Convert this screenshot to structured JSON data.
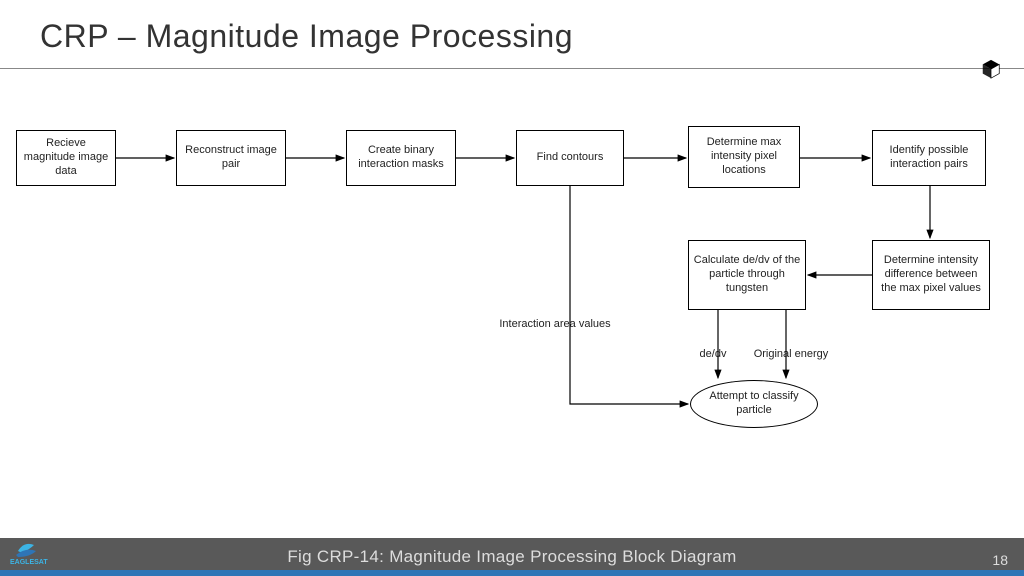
{
  "title": "CRP – Magnitude Image Processing",
  "footer": "Fig CRP-14: Magnitude Image Processing Block Diagram",
  "page": "18",
  "logo_text": "EAGLESAT",
  "boxes": {
    "b1": "Recieve magnitude image data",
    "b2": "Reconstruct image pair",
    "b3": "Create binary interaction masks",
    "b4": "Find contours",
    "b5": "Determine max intensity pixel locations",
    "b6": "Identify possible interaction pairs",
    "b7": "Determine intensity difference between the max pixel values",
    "b8": "Calculate de/dv of the particle through tungsten",
    "b9": "Attempt to classify particle"
  },
  "labels": {
    "l1": "Interaction area values",
    "l2": "de/dv",
    "l3": "Original energy"
  }
}
